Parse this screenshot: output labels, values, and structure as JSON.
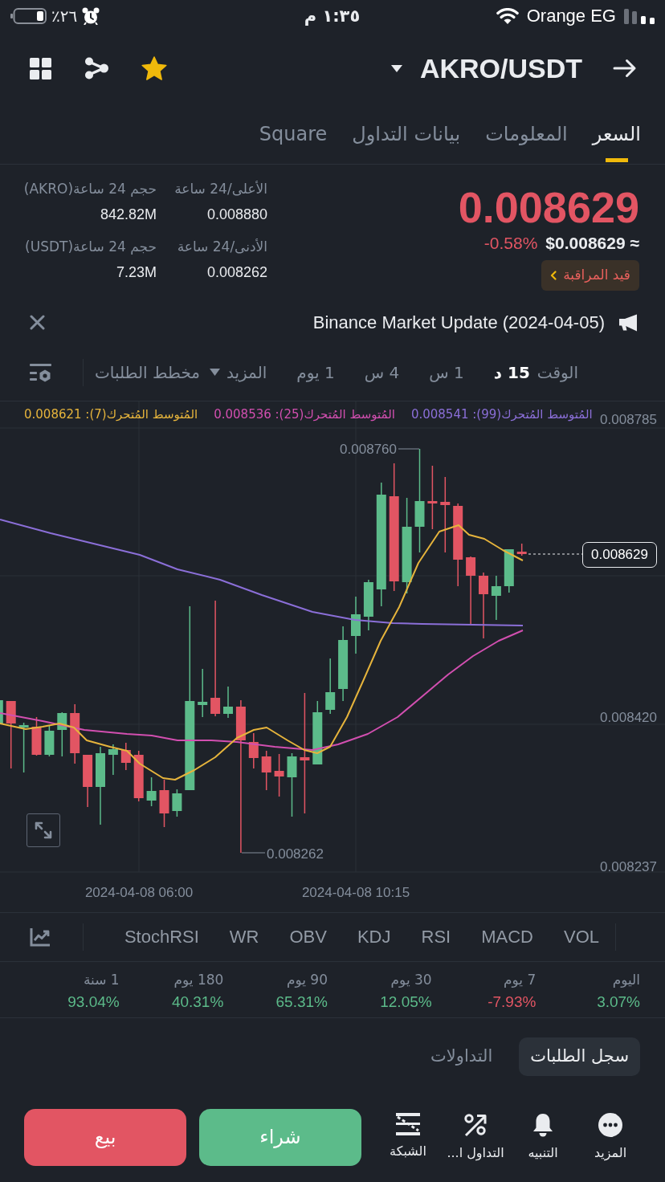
{
  "status_bar": {
    "battery": "٢٦٪",
    "time": "١:٣٥ م",
    "carrier": "Orange EG"
  },
  "header": {
    "pair": "AKRO/USDT",
    "favorite": true
  },
  "tabs": [
    {
      "label": "السعر",
      "selected": true
    },
    {
      "label": "المعلومات",
      "selected": false
    },
    {
      "label": "بيانات التداول",
      "selected": false
    },
    {
      "label": "Square",
      "selected": false
    }
  ],
  "ticker": {
    "price": "0.008629",
    "rising": false,
    "change": "-0.58%",
    "usd_price": "≈ $0.008629",
    "watch_tag": "قيد المراقبة"
  },
  "stats": [
    {
      "label": "الأعلى/24 ساعة",
      "value": "0.008880"
    },
    {
      "label": "حجم 24 ساعة(AKRO)",
      "value": "842.82M"
    },
    {
      "label": "الأدنى/24 ساعة",
      "value": "0.008262"
    },
    {
      "label": "حجم 24 ساعة(USDT)",
      "value": "7.23M"
    }
  ],
  "announcement": "Binance Market Update (2024-04-05)",
  "intervals": {
    "label": "الوقت",
    "items": [
      {
        "label": "15 د",
        "selected": true
      },
      {
        "label": "1 س",
        "selected": false
      },
      {
        "label": "4 س",
        "selected": false
      },
      {
        "label": "1 يوم",
        "selected": false
      }
    ],
    "more": "المزيد",
    "depth_chart": "مخطط الطلبات"
  },
  "chart": {
    "moving_averages": [
      {
        "label": "المُتوسط المُتحرك(99): 0.008541",
        "color": "#8b6fd8"
      },
      {
        "label": "المُتوسط المُتحرك(25): 0.008536",
        "color": "#d24fb0"
      },
      {
        "label": "المُتوسط المُتحرك(7): 0.008621",
        "color": "#e6b43c"
      }
    ],
    "price_axis": [
      "0.008785",
      "0.008420",
      "0.008237"
    ],
    "time_axis": [
      "2024-04-08 10:15",
      "2024-04-08 06:00"
    ],
    "high_label": "0.008760",
    "low_label": "0.008262",
    "last_price": "0.008629"
  },
  "indicators": [
    "VOL",
    "MACD",
    "RSI",
    "KDJ",
    "OBV",
    "WR",
    "StochRSI"
  ],
  "returns": [
    {
      "period": "اليوم",
      "value": "3.07%",
      "rising": true
    },
    {
      "period": "7 يوم",
      "value": "-7.93%",
      "rising": false
    },
    {
      "period": "30 يوم",
      "value": "12.05%",
      "rising": true
    },
    {
      "period": "90 يوم",
      "value": "65.31%",
      "rising": true
    },
    {
      "period": "180 يوم",
      "value": "40.31%",
      "rising": true
    },
    {
      "period": "1 سنة",
      "value": "93.04%",
      "rising": true
    }
  ],
  "order_tabs": [
    {
      "label": "سجل الطلبات",
      "selected": true
    },
    {
      "label": "التداولات",
      "selected": false
    }
  ],
  "bottom_bar": {
    "actions": [
      {
        "label": "المزيد",
        "kind": "more"
      },
      {
        "label": "التنبيه",
        "kind": "alert"
      },
      {
        "label": "التداول ا...",
        "kind": "margin"
      },
      {
        "label": "الشبكة",
        "kind": "grid"
      }
    ],
    "buttons": [
      {
        "label": "شراء",
        "kind": "buy"
      },
      {
        "label": "بيع",
        "kind": "sell"
      }
    ]
  }
}
